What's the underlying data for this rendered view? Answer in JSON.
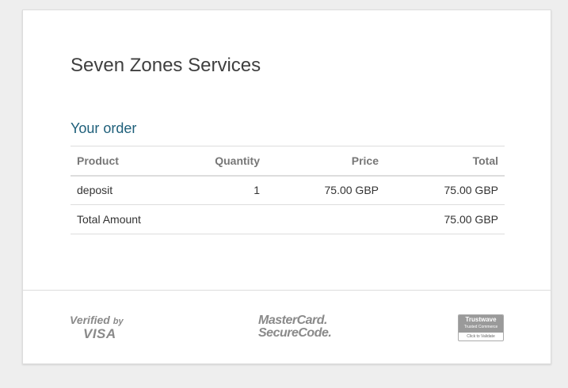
{
  "merchant": {
    "name": "Seven Zones Services"
  },
  "order": {
    "heading": "Your order",
    "columns": [
      "Product",
      "Quantity",
      "Price",
      "Total"
    ],
    "rows": [
      {
        "product": "deposit",
        "quantity": "1",
        "price": "75.00 GBP",
        "total": "75.00 GBP"
      }
    ],
    "total_label": "Total Amount",
    "total_value": "75.00 GBP"
  },
  "footer": {
    "visa": {
      "line1": "Verified",
      "by": "by",
      "line2": "VISA"
    },
    "mastercard": {
      "line1": "MasterCard.",
      "line2": "SecureCode."
    },
    "trustwave": {
      "brand": "Trustwave",
      "sub": "Trusted Commerce",
      "cta": "Click to Validate"
    }
  },
  "colors": {
    "heading_accent": "#1e5f7a",
    "page_bg": "#eeeeee",
    "card_bg": "#ffffff",
    "divider": "#dddddd"
  }
}
